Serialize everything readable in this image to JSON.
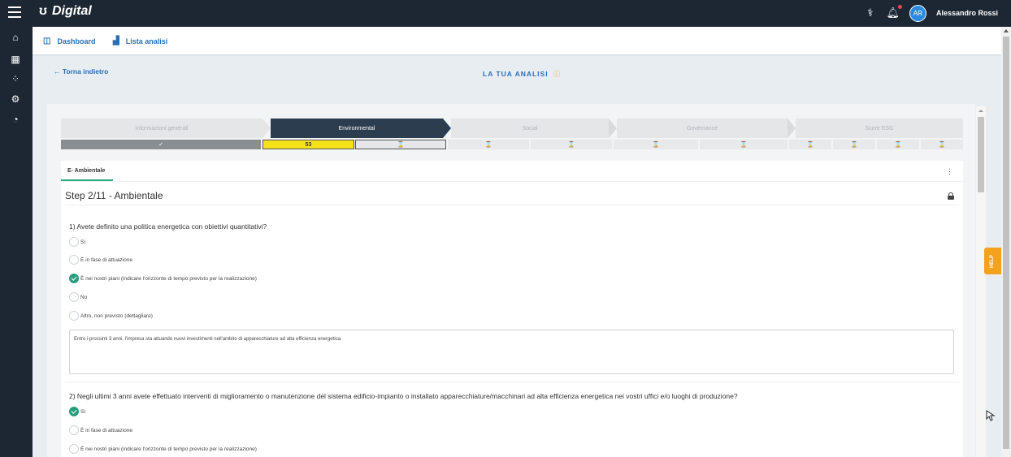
{
  "app": {
    "logo_text": "Digital"
  },
  "user": {
    "initials": "AR",
    "name": "Alessandro Rossi"
  },
  "topbar_icons": [
    "connection-icon",
    "bell-icon"
  ],
  "sidebar": {
    "icons": [
      "home-icon",
      "building-icon",
      "network-icon",
      "users-gear-icon",
      "dashboard-gauge-icon"
    ]
  },
  "subnav": {
    "dashboard": "Dashboard",
    "analysis_list": "Lista analisi"
  },
  "page": {
    "back": "← Torna indietro",
    "title": "LA TUA ANALISI",
    "info_icon": "ⓘ"
  },
  "stepper": {
    "steps": [
      "Informazioni generali",
      "Environmental",
      "Social",
      "Governance",
      "Score ESG"
    ],
    "active": "Environmental",
    "general_check": "✓",
    "env_score": "53",
    "hourglass": "⌛"
  },
  "card": {
    "tab": "E- Ambientale",
    "menu": "⋮",
    "step_title": "Step 2/11 - Ambientale"
  },
  "q1": {
    "text": "1) Avete definito una politica energetica con obiettivi quantitativi?",
    "options": [
      "Sì",
      "È in fase di attuazione",
      "È nei nostri piani (indicare l'orizzonte di tempo previsto per la realizzazione)",
      "No",
      "Altro, non previsto (dettagliare)"
    ],
    "selected": 2,
    "answer": "Entro i prossimi 3 anni, l'impresa sta attuando nuovi investimenti nell'ambito di apparecchiature ad alta efficienza energetica."
  },
  "q2": {
    "text": "2) Negli ultimi 3 anni avete effettuato interventi di miglioramento o manutenzione del sistema edificio-impianto o installato apparecchiature/macchinari ad alta efficienza energetica nei vostri uffici e/o luoghi di produzione?",
    "options": [
      "Sì",
      "È in fase di attuazione",
      "È nei nostri piani (indicare l'orizzonte di tempo previsto per la realizzazione)"
    ],
    "selected": 0
  },
  "help": "HELP",
  "colors": {
    "nav": "#1c2733",
    "accent": "#2a6fb5",
    "check": "#2a9d7e",
    "score": "#f5e11a",
    "help": "#f4a11d"
  }
}
